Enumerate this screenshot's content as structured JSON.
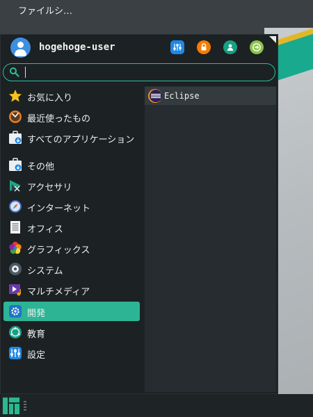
{
  "desktop": {
    "icon_label": "ファイルシ…"
  },
  "menu": {
    "user": {
      "name": "hogehoge-user"
    },
    "header_buttons": [
      {
        "name": "settings-button",
        "icon": "settings-icon",
        "color": "#1e88e5"
      },
      {
        "name": "lock-screen-button",
        "icon": "lock-icon",
        "color": "#f57c00"
      },
      {
        "name": "switch-user-button",
        "icon": "user-icon",
        "color": "#16a085"
      },
      {
        "name": "logout-button",
        "icon": "logout-icon",
        "color": "#8bc34a"
      }
    ],
    "search": {
      "value": "",
      "placeholder": ""
    },
    "categories": [
      {
        "label": "お気に入り",
        "icon": "star-icon",
        "active": false
      },
      {
        "label": "最近使ったもの",
        "icon": "recent-icon",
        "active": false
      },
      {
        "label": "すべてのアプリケーション",
        "icon": "all-apps-icon",
        "active": false
      },
      {
        "label": "その他",
        "icon": "other-icon",
        "active": false
      },
      {
        "label": "アクセサリ",
        "icon": "accessories-icon",
        "active": false
      },
      {
        "label": "インターネット",
        "icon": "internet-icon",
        "active": false
      },
      {
        "label": "オフィス",
        "icon": "office-icon",
        "active": false
      },
      {
        "label": "グラフィックス",
        "icon": "graphics-icon",
        "active": false
      },
      {
        "label": "システム",
        "icon": "system-icon",
        "active": false
      },
      {
        "label": "マルチメディア",
        "icon": "multimedia-icon",
        "active": false
      },
      {
        "label": "開発",
        "icon": "development-icon",
        "active": true
      },
      {
        "label": "教育",
        "icon": "education-icon",
        "active": false
      },
      {
        "label": "設定",
        "icon": "settings-category-icon",
        "active": false
      }
    ],
    "apps": [
      {
        "label": "Eclipse",
        "icon": "eclipse-icon"
      }
    ]
  },
  "colors": {
    "accent": "#2db495",
    "menu_bg": "#1c2124",
    "apps_bg": "#262c2f"
  }
}
